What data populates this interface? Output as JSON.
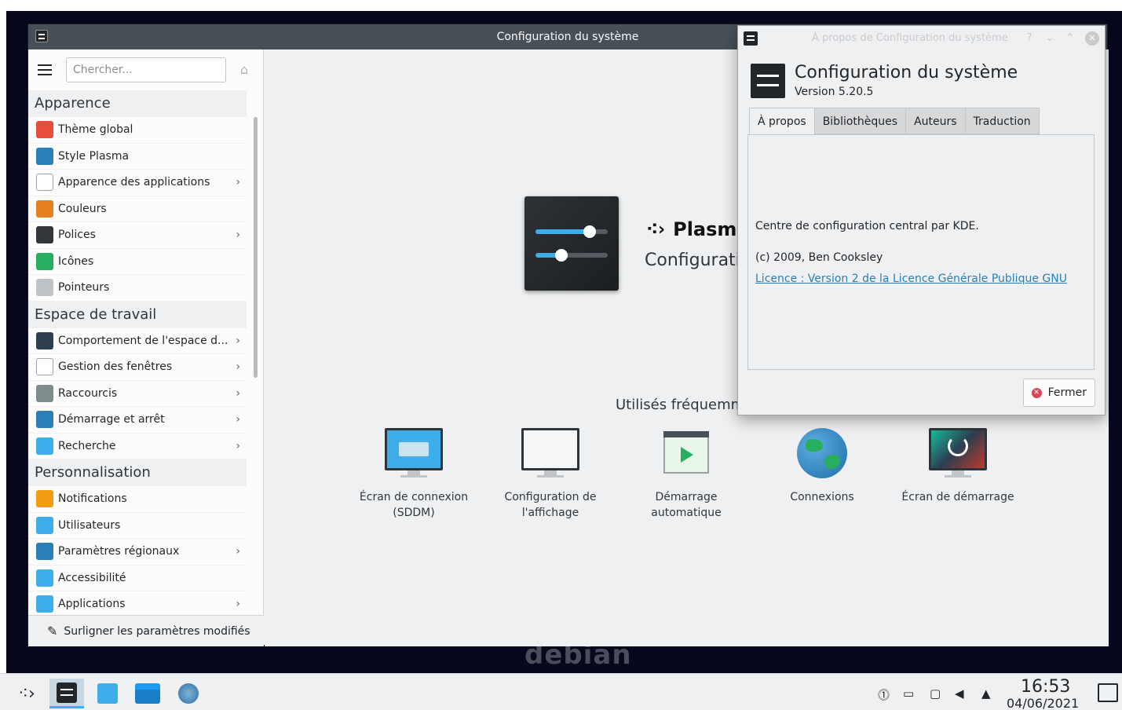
{
  "main_window": {
    "title": "Configuration du système"
  },
  "sidebar": {
    "search": {
      "placeholder": "Chercher..."
    },
    "sections": [
      {
        "title": "Apparence",
        "items": [
          {
            "label": "Thème global",
            "icon": "global-theme-icon",
            "color": "#e74c3c",
            "chevron": false
          },
          {
            "label": "Style Plasma",
            "icon": "plasma-style-icon",
            "color": "#2980b9",
            "chevron": false
          },
          {
            "label": "Apparence des applications",
            "icon": "app-style-icon",
            "color": "#ffffff",
            "chevron": true
          },
          {
            "label": "Couleurs",
            "icon": "colors-icon",
            "color": "#e67e22",
            "chevron": false
          },
          {
            "label": "Polices",
            "icon": "fonts-icon",
            "color": "#31363b",
            "chevron": true
          },
          {
            "label": "Icônes",
            "icon": "icons-icon",
            "color": "#27ae60",
            "chevron": false
          },
          {
            "label": "Pointeurs",
            "icon": "cursors-icon",
            "color": "#bdc3c7",
            "chevron": false
          }
        ]
      },
      {
        "title": "Espace de travail",
        "items": [
          {
            "label": "Comportement de l'espace d...",
            "icon": "workspace-behavior-icon",
            "color": "#2c3e50",
            "chevron": true
          },
          {
            "label": "Gestion des fenêtres",
            "icon": "window-management-icon",
            "color": "#ffffff",
            "chevron": true
          },
          {
            "label": "Raccourcis",
            "icon": "shortcuts-icon",
            "color": "#7f8c8d",
            "chevron": true
          },
          {
            "label": "Démarrage et arrêt",
            "icon": "startup-shutdown-icon",
            "color": "#2980b9",
            "chevron": true
          },
          {
            "label": "Recherche",
            "icon": "search-icon",
            "color": "#3daee9",
            "chevron": true
          }
        ]
      },
      {
        "title": "Personnalisation",
        "items": [
          {
            "label": "Notifications",
            "icon": "notifications-icon",
            "color": "#f39c12",
            "chevron": false
          },
          {
            "label": "Utilisateurs",
            "icon": "users-icon",
            "color": "#3daee9",
            "chevron": false
          },
          {
            "label": "Paramètres régionaux",
            "icon": "regional-settings-icon",
            "color": "#2980b9",
            "chevron": true
          },
          {
            "label": "Accessibilité",
            "icon": "accessibility-icon",
            "color": "#3daee9",
            "chevron": false
          },
          {
            "label": "Applications",
            "icon": "applications-icon",
            "color": "#3daee9",
            "chevron": true
          }
        ]
      }
    ],
    "footer_label": "Surligner les paramètres modifiés"
  },
  "content": {
    "plasma_name": "Plasma",
    "subtitle": "Configurati",
    "frequent_title": "Utilisés fréquemm",
    "frequent_items": [
      {
        "line1": "Écran de connexion",
        "line2": "(SDDM)",
        "icon": "login-screen-icon"
      },
      {
        "line1": "Configuration de",
        "line2": "l'affichage",
        "icon": "display-config-icon"
      },
      {
        "line1": "Démarrage",
        "line2": "automatique",
        "icon": "autostart-icon"
      },
      {
        "line1": "Connexions",
        "line2": "",
        "icon": "connections-icon"
      },
      {
        "line1": "Écran de démarrage",
        "line2": "",
        "icon": "splash-screen-icon"
      }
    ]
  },
  "wallpaper_text": "debian",
  "about_dialog": {
    "window_title": "À propos de Configuration du système",
    "title": "Configuration du système",
    "version": "Version 5.20.5",
    "tabs": [
      "À propos",
      "Bibliothèques",
      "Auteurs",
      "Traduction"
    ],
    "description": "Centre de configuration central par KDE.",
    "copyright": "(c) 2009, Ben Cooksley",
    "license_link": "Licence : Version 2 de la Licence Générale Publique GNU",
    "close_button": "Fermer"
  },
  "taskbar": {
    "time": "16:53",
    "date": "04/06/2021"
  }
}
